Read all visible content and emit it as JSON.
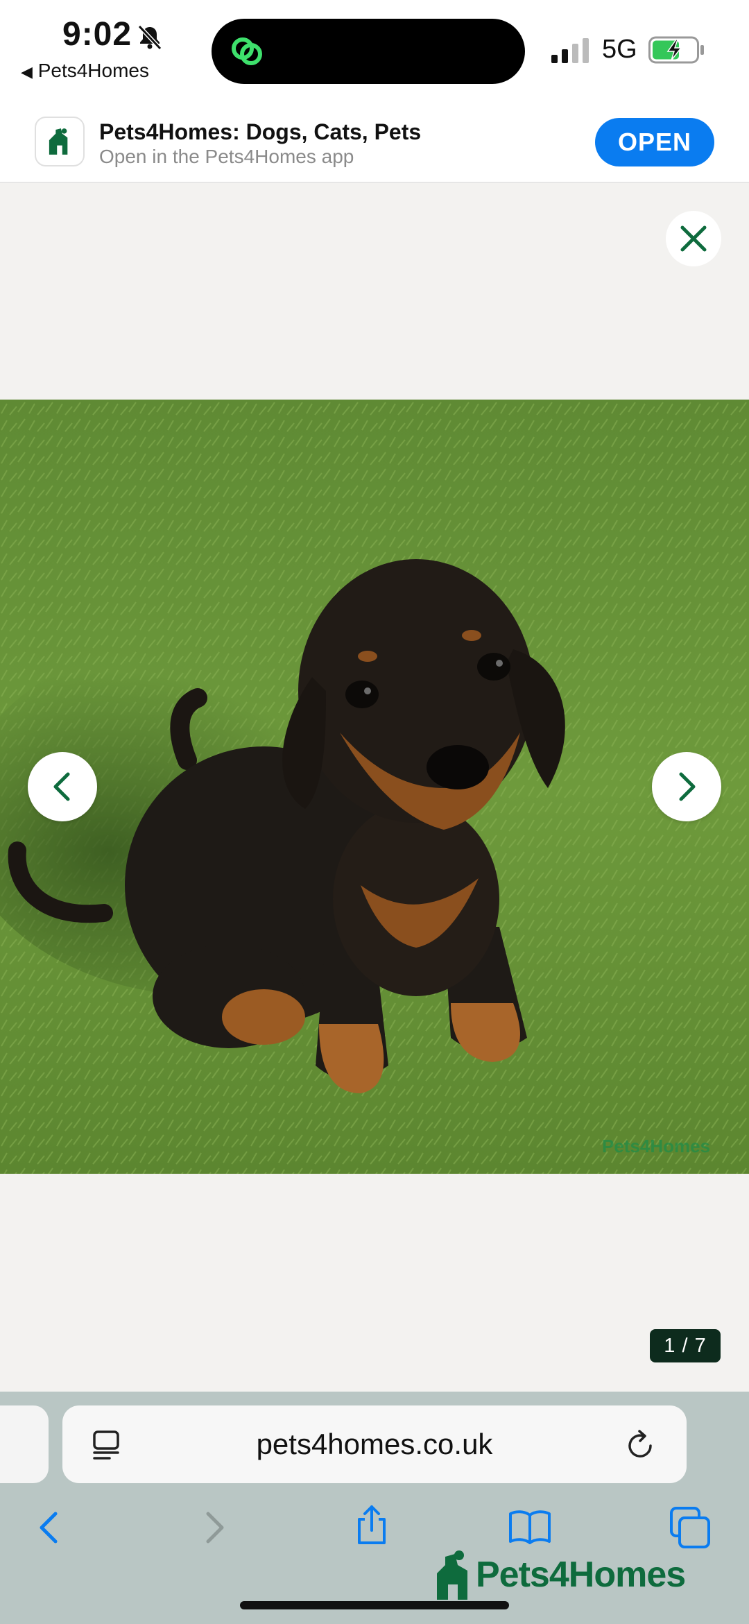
{
  "status_bar": {
    "time": "9:02",
    "back_app": "Pets4Homes",
    "network": "5G",
    "icons": [
      "bell-slash-icon",
      "activity-icon",
      "signal-icon",
      "battery-charging-icon"
    ]
  },
  "app_banner": {
    "title": "Pets4Homes: Dogs, Cats, Pets",
    "subtitle": "Open in the Pets4Homes app",
    "open_label": "OPEN",
    "accent": "#0a7cf0"
  },
  "gallery": {
    "counter": "1 / 7",
    "watermark": "Pets4Homes",
    "icons": [
      "close-icon",
      "chevron-left-icon",
      "chevron-right-icon"
    ]
  },
  "browser": {
    "url": "pets4homes.co.uk",
    "icons": [
      "reader-icon",
      "reload-icon",
      "back-arrow-icon",
      "forward-arrow-icon",
      "share-icon",
      "bookmarks-icon",
      "tabs-icon"
    ]
  },
  "footer_logo": {
    "text": "Pets4Homes",
    "color": "#0e6b3d"
  }
}
